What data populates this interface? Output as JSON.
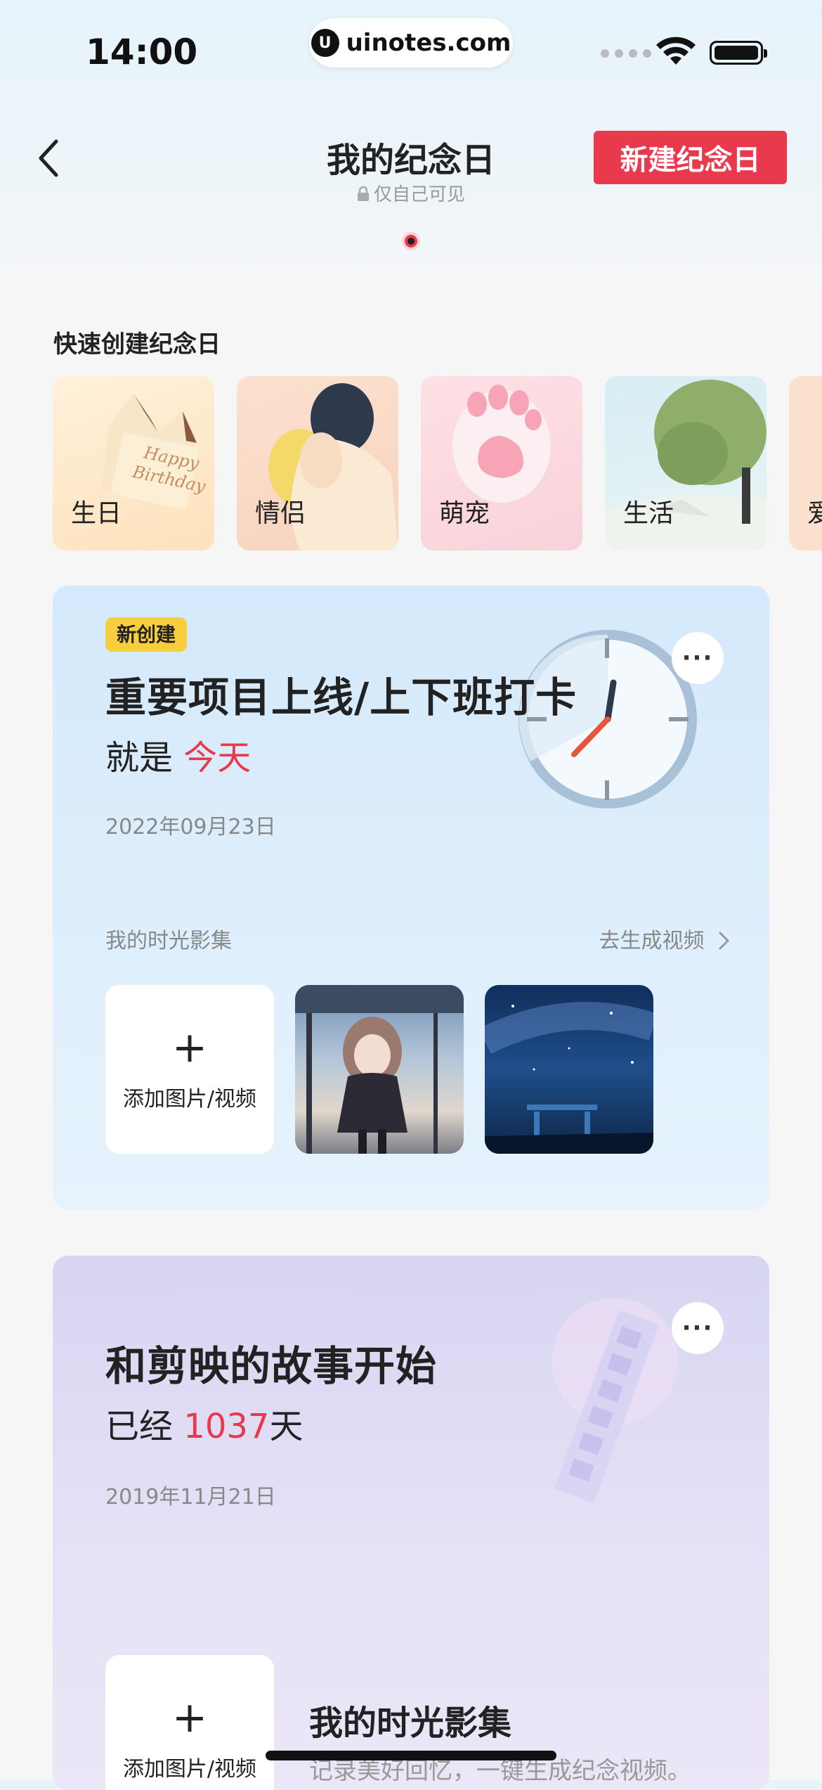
{
  "status_bar": {
    "time": "14:00",
    "url": "uinotes.com",
    "url_logo": "U"
  },
  "header": {
    "title": "我的纪念日",
    "subtitle": "仅自己可见",
    "new_button": "新建纪念日"
  },
  "quick_create": {
    "label": "快速创建纪念日",
    "items": [
      {
        "label": "生日"
      },
      {
        "label": "情侣"
      },
      {
        "label": "萌宠"
      },
      {
        "label": "生活"
      },
      {
        "label": "爱"
      }
    ]
  },
  "events": [
    {
      "badge": "新创建",
      "title": "重要项目上线/上下班打卡",
      "count_prefix": "就是",
      "count_value": "今天",
      "count_suffix": "",
      "date": "2022年09月23日",
      "more": "···",
      "album_label": "我的时光影集",
      "album_action": "去生成视频",
      "add_label": "添加图片/视频"
    },
    {
      "title": "和剪映的故事开始",
      "count_prefix": "已经",
      "count_value": "1037",
      "count_suffix": "天",
      "date": "2019年11月21日",
      "more": "···",
      "add_label": "添加图片/视频",
      "album_title": "我的时光影集",
      "album_desc": "记录美好回忆，一键生成纪念视频。"
    }
  ],
  "colors": {
    "accent": "#e8394d",
    "badge": "#f7cf3e"
  }
}
